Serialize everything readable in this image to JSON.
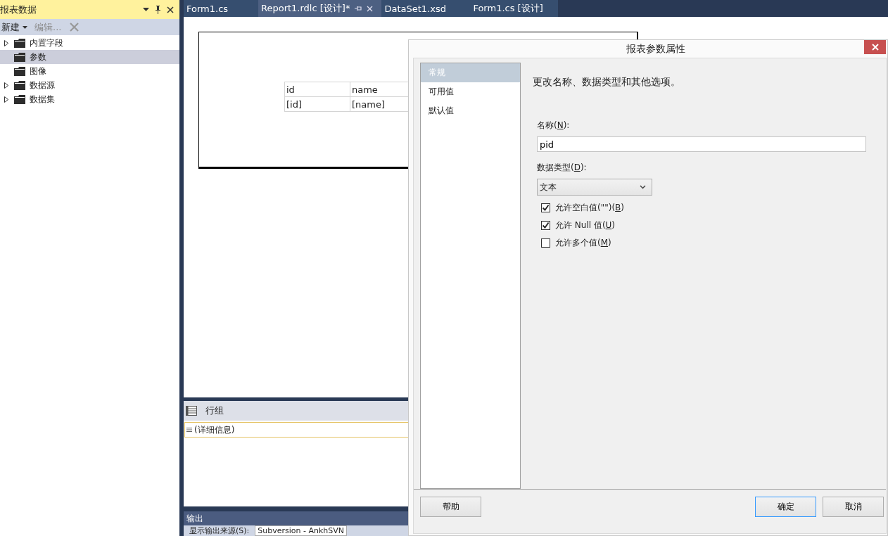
{
  "report_data_panel": {
    "title": "报表数据",
    "toolbar": [
      {
        "label": "新建",
        "kind": "dropdown",
        "disabled": false
      },
      {
        "label": "编辑...",
        "kind": "plain",
        "disabled": true
      },
      {
        "kind": "delete",
        "disabled": true
      }
    ],
    "tree": [
      {
        "label": "内置字段",
        "expandable": true,
        "selected": false
      },
      {
        "label": "参数",
        "expandable": false,
        "selected": true
      },
      {
        "label": "图像",
        "expandable": false,
        "selected": false
      },
      {
        "label": "数据源",
        "expandable": true,
        "selected": false
      },
      {
        "label": "数据集",
        "expandable": true,
        "selected": false
      }
    ]
  },
  "tabs": [
    {
      "label": "Form1.cs",
      "selected": false
    },
    {
      "label": "Report1.rdlc [设计]*",
      "selected": true
    },
    {
      "label": "DataSet1.xsd",
      "selected": false
    },
    {
      "label": "Form1.cs [设计]",
      "selected": false
    }
  ],
  "report_table": {
    "header": [
      "id",
      "name"
    ],
    "row": [
      "[id]",
      "[name]"
    ]
  },
  "row_groups": {
    "title": "行组",
    "items": [
      "(详细信息)"
    ]
  },
  "output": {
    "title": "输出",
    "source_label": "显示输出来源(S):",
    "source_value": "Subversion - AnkhSVN"
  },
  "dialog": {
    "title": "报表参数属性",
    "nav": [
      {
        "label": "常规",
        "selected": true
      },
      {
        "label": "可用值",
        "selected": false
      },
      {
        "label": "默认值",
        "selected": false
      }
    ],
    "heading": "更改名称、数据类型和其他选项。",
    "name_label": {
      "before": "名称(",
      "key": "N",
      "after": "):"
    },
    "name_value": "pid",
    "type_label": {
      "before": "数据类型(",
      "key": "D",
      "after": "):"
    },
    "type_value": "文本",
    "options": [
      {
        "before": "允许空白值(\"\")(",
        "key": "B",
        "after": ")",
        "checked": true
      },
      {
        "before": "允许 Null 值(",
        "key": "U",
        "after": ")",
        "checked": true
      },
      {
        "before": "允许多个值(",
        "key": "M",
        "after": ")",
        "checked": false
      }
    ],
    "buttons": [
      {
        "label": "帮助",
        "kind": "help",
        "default": false
      },
      {
        "label": "确定",
        "kind": "ok",
        "default": true
      },
      {
        "label": "取消",
        "kind": "cancel",
        "default": false
      }
    ]
  }
}
